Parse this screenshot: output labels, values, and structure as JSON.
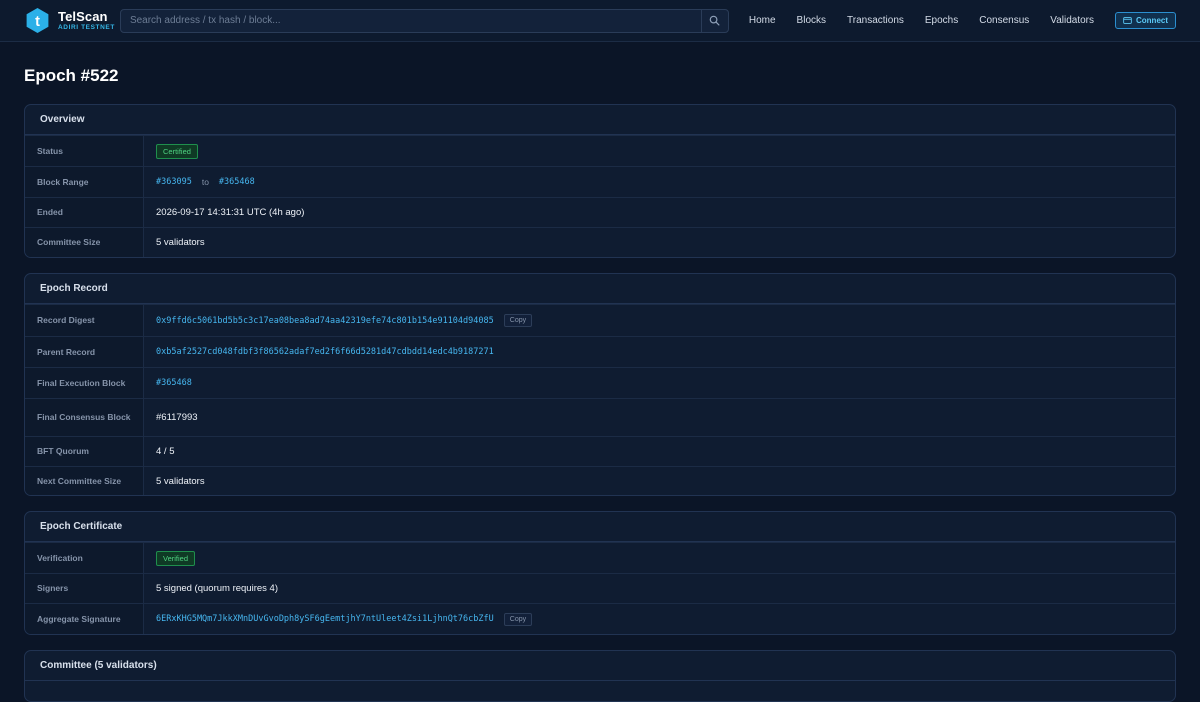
{
  "header": {
    "brand_name": "TelScan",
    "network": "ADIRI TESTNET",
    "search_placeholder": "Search address / tx hash / block...",
    "nav": [
      "Home",
      "Blocks",
      "Transactions",
      "Epochs",
      "Consensus",
      "Validators"
    ],
    "connect_label": "Connect"
  },
  "page": {
    "title": "Epoch #522"
  },
  "overview": {
    "title": "Overview",
    "status_label": "Status",
    "status_value": "Certified",
    "block_range_label": "Block Range",
    "block_range_start": "#363095",
    "block_range_to": "to",
    "block_range_end": "#365468",
    "ended_label": "Ended",
    "ended_value": "2026-09-17 14:31:31 UTC (4h ago)",
    "committee_label": "Committee Size",
    "committee_value": "5 validators"
  },
  "record": {
    "title": "Epoch Record",
    "digest_label": "Record Digest",
    "digest_value": "0x9ffd6c5061bd5b5c3c17ea08bea8ad74aa42319efe74c801b154e91104d94085",
    "copy_label": "Copy",
    "parent_label": "Parent Record",
    "parent_value": "0xb5af2527cd048fdbf3f86562adaf7ed2f6f66d5281d47cdbdd14edc4b9187271",
    "final_exec_label": "Final Execution Block",
    "final_exec_value": "#365468",
    "final_consensus_label": "Final Consensus Block",
    "final_consensus_value": "#6117993",
    "bft_label": "BFT Quorum",
    "bft_value": "4 / 5",
    "next_committee_label": "Next Committee Size",
    "next_committee_value": "5 validators"
  },
  "certificate": {
    "title": "Epoch Certificate",
    "verification_label": "Verification",
    "verification_value": "Verified",
    "signers_label": "Signers",
    "signers_value": "5 signed (quorum requires 4)",
    "signature_label": "Aggregate Signature",
    "signature_value": "6ERxKHG5MQm7JkkXMnDUvGvoDph8ySF6gEemtjhY7ntUleet4Zsi1LjhnQt76cbZfU",
    "copy_label": "Copy"
  },
  "committee": {
    "title": "Committee (5 validators)"
  },
  "colors": {
    "accent": "#46b6ef",
    "success": "#4fd382",
    "background": "#0b1527"
  }
}
